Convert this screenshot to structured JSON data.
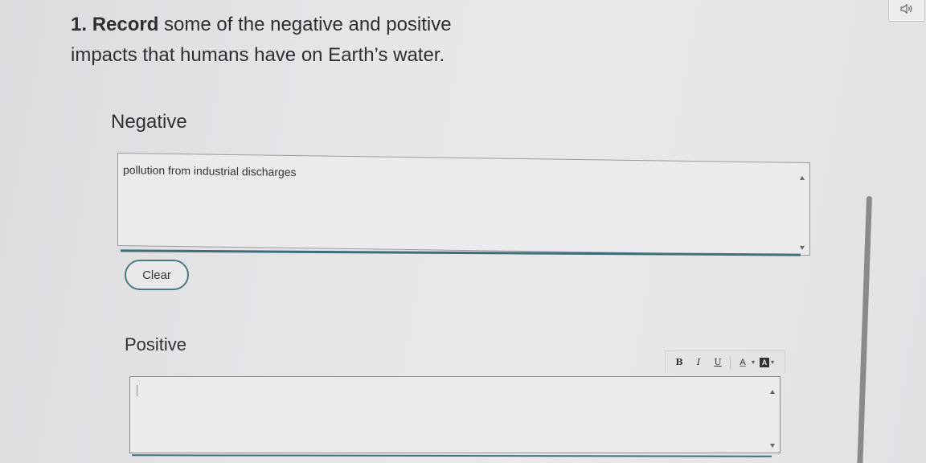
{
  "question": {
    "number": "1.",
    "bold_word": "Record",
    "line1_rest": " some of the negative and positive",
    "line2": "impacts that humans have on Earth’s water."
  },
  "negative": {
    "label": "Negative",
    "value": "pollution from industrial discharges"
  },
  "clear_button": {
    "label": "Clear"
  },
  "positive": {
    "label": "Positive",
    "value": ""
  },
  "toolbar": {
    "bold": "B",
    "italic": "I",
    "underline": "U",
    "font_color": "A",
    "font_color_caret": "▾",
    "bg_color": "A",
    "bg_color_caret": "▾"
  },
  "colors": {
    "accent_teal": "#3e6f78",
    "background": "#e6e6e9"
  },
  "icons": {
    "speaker": "speaker-icon"
  }
}
